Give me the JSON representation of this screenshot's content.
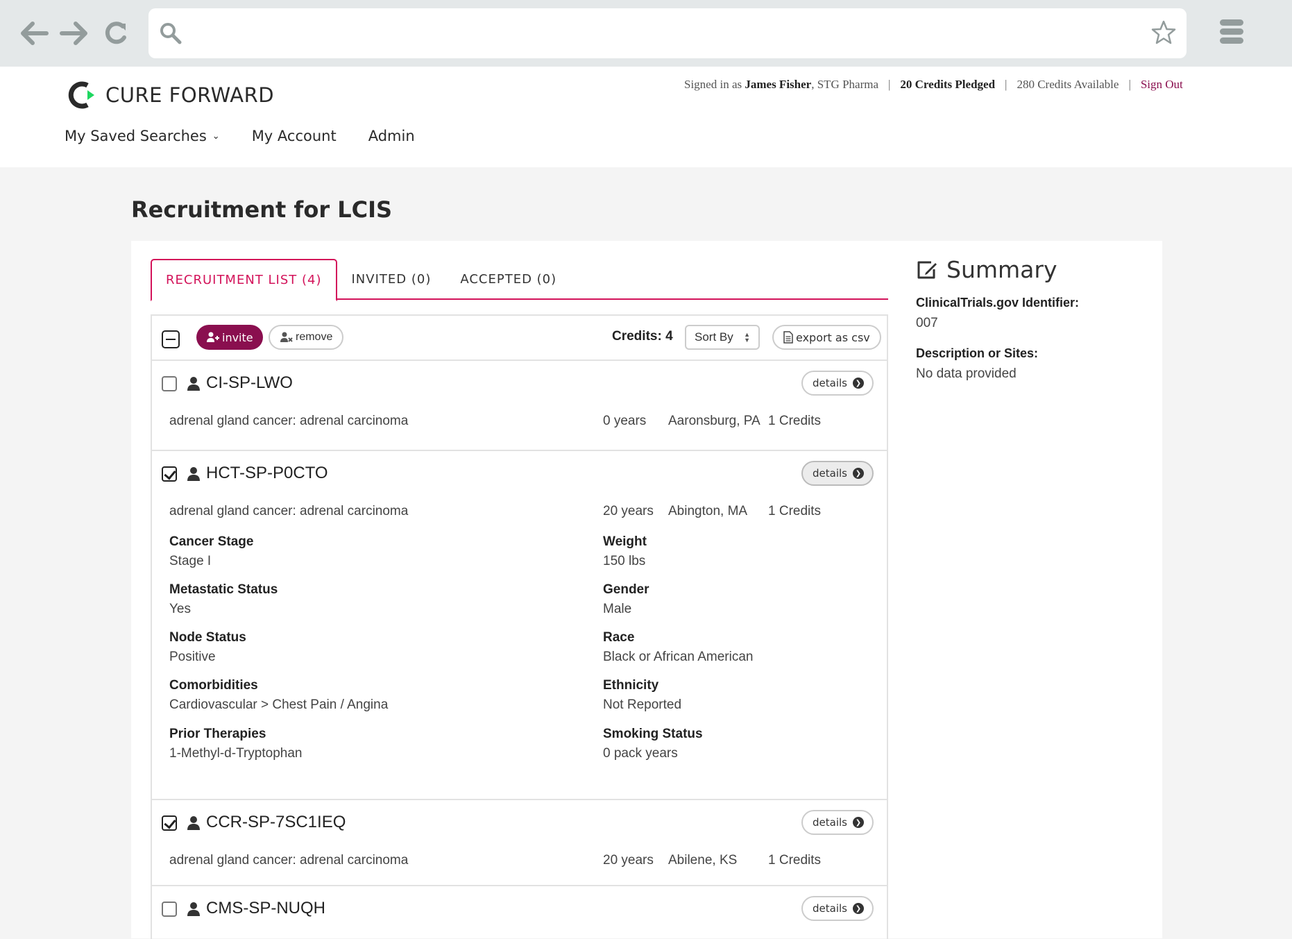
{
  "browser": {
    "url_value": "",
    "icons": [
      "back-arrow-icon",
      "forward-arrow-icon",
      "reload-icon",
      "search-icon",
      "star-icon",
      "menu-icon"
    ]
  },
  "header": {
    "brand": "CURE FORWARD",
    "signed_in_prefix": "Signed in as ",
    "user_name": "James Fisher",
    "company": ", STG Pharma",
    "credits_pledged": "20 Credits Pledged",
    "credits_available": "280 Credits Available",
    "sign_out": "Sign Out",
    "separator": "|",
    "nav": [
      "My Saved Searches",
      "My Account",
      "Admin"
    ]
  },
  "colors": {
    "accent_pink": "#d3135a",
    "invite_purple": "#8a0f4f",
    "logo_green": "#1ed760",
    "browser_gray": "#e4e8e9",
    "page_bg": "#f4f4f4"
  },
  "page": {
    "title": "Recruitment for LCIS",
    "tabs": [
      {
        "label": "RECRUITMENT LIST (4)",
        "active": true
      },
      {
        "label": "INVITED (0)",
        "active": false
      },
      {
        "label": "ACCEPTED (0)",
        "active": false
      }
    ],
    "toolbar": {
      "invite": "invite",
      "remove": "remove",
      "credits": "Credits: 4",
      "sort": "Sort By",
      "export": "export as csv"
    },
    "details_label": "details",
    "items": [
      {
        "id": "CI-SP-LWO",
        "checked": false,
        "expanded": false,
        "diagnosis": "adrenal gland cancer: adrenal carcinoma",
        "age": "0 years",
        "location": "Aaronsburg, PA",
        "credits": "1 Credits"
      },
      {
        "id": "HCT-SP-P0CTO",
        "checked": true,
        "expanded": true,
        "diagnosis": "adrenal gland cancer: adrenal carcinoma",
        "age": "20 years",
        "location": "Abington, MA",
        "credits": "1 Credits",
        "details": [
          {
            "label": "Cancer Stage",
            "value": "Stage I"
          },
          {
            "label": "Weight",
            "value": "150 lbs"
          },
          {
            "label": "Metastatic Status",
            "value": "Yes"
          },
          {
            "label": "Gender",
            "value": "Male"
          },
          {
            "label": "Node Status",
            "value": "Positive"
          },
          {
            "label": "Race",
            "value": "Black or African American"
          },
          {
            "label": "Comorbidities",
            "value": "Cardiovascular > Chest Pain / Angina"
          },
          {
            "label": "Ethnicity",
            "value": "Not Reported"
          },
          {
            "label": "Prior Therapies",
            "value": "1-Methyl-d-Tryptophan"
          },
          {
            "label": "Smoking Status",
            "value": "0 pack years"
          }
        ]
      },
      {
        "id": "CCR-SP-7SC1IEQ",
        "checked": true,
        "expanded": false,
        "diagnosis": "adrenal gland cancer: adrenal carcinoma",
        "age": "20 years",
        "location": "Abilene, KS",
        "credits": "1 Credits"
      },
      {
        "id": "CMS-SP-NUQH",
        "checked": false,
        "expanded": false
      }
    ]
  },
  "summary": {
    "title": "Summary",
    "fields": [
      {
        "label": "ClinicalTrials.gov Identifier:",
        "value": "007"
      },
      {
        "label": "Description or Sites:",
        "value": "No data provided"
      }
    ]
  }
}
